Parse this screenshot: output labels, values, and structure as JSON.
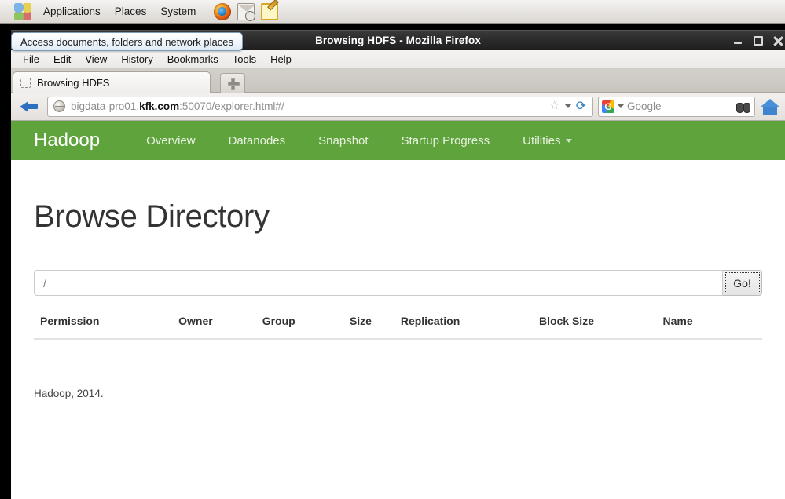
{
  "desktop": {
    "panel": {
      "menus": [
        {
          "label": "Applications",
          "icon": "applications-icon"
        },
        {
          "label": "Places",
          "icon": "places-icon"
        },
        {
          "label": "System",
          "icon": "system-icon"
        }
      ],
      "launchers": [
        {
          "name": "firefox-icon",
          "title": "Firefox Web Browser"
        },
        {
          "name": "evolution-mail-icon",
          "title": "Evolution Mail"
        },
        {
          "name": "text-editor-icon",
          "title": "Text Editor"
        }
      ]
    },
    "tooltip": {
      "text": "Access documents, folders and network places"
    }
  },
  "window": {
    "title": "Browsing HDFS - Mozilla Firefox",
    "controls": {
      "minimize": "minimize-button",
      "maximize": "maximize-button",
      "close": "close-button"
    }
  },
  "menubar": {
    "items": [
      {
        "label": "File",
        "accel": "F"
      },
      {
        "label": "Edit",
        "accel": "E"
      },
      {
        "label": "View",
        "accel": "V"
      },
      {
        "label": "History",
        "accel": "s"
      },
      {
        "label": "Bookmarks",
        "accel": "B"
      },
      {
        "label": "Tools",
        "accel": "T"
      },
      {
        "label": "Help",
        "accel": "H"
      }
    ]
  },
  "tabs": {
    "active": {
      "title": "Browsing HDFS"
    },
    "new_tab_label": "+"
  },
  "toolbar": {
    "back_label": "Back",
    "url": {
      "prefix": "bigdata-pro01.",
      "host": "kfk.com",
      "suffix": ":50070/explorer.html#/",
      "full": "bigdata-pro01.kfk.com:50070/explorer.html#/"
    },
    "bookmark_icon": "☆",
    "reload_icon": "⟳",
    "search": {
      "engine": "Google",
      "placeholder": "Google",
      "value": ""
    },
    "home_icon": "home-icon"
  },
  "hadoop": {
    "brand": "Hadoop",
    "nav": [
      {
        "label": "Overview",
        "dropdown": false
      },
      {
        "label": "Datanodes",
        "dropdown": false
      },
      {
        "label": "Snapshot",
        "dropdown": false
      },
      {
        "label": "Startup Progress",
        "dropdown": false
      },
      {
        "label": "Utilities",
        "dropdown": true
      }
    ],
    "nav_color": "#5fa33c",
    "page_title": "Browse Directory",
    "path_input": {
      "value": "/",
      "placeholder": ""
    },
    "go_button": "Go!",
    "table": {
      "headers": [
        "Permission",
        "Owner",
        "Group",
        "Size",
        "Replication",
        "Block Size",
        "Name"
      ],
      "rows": []
    },
    "footer": "Hadoop, 2014."
  }
}
